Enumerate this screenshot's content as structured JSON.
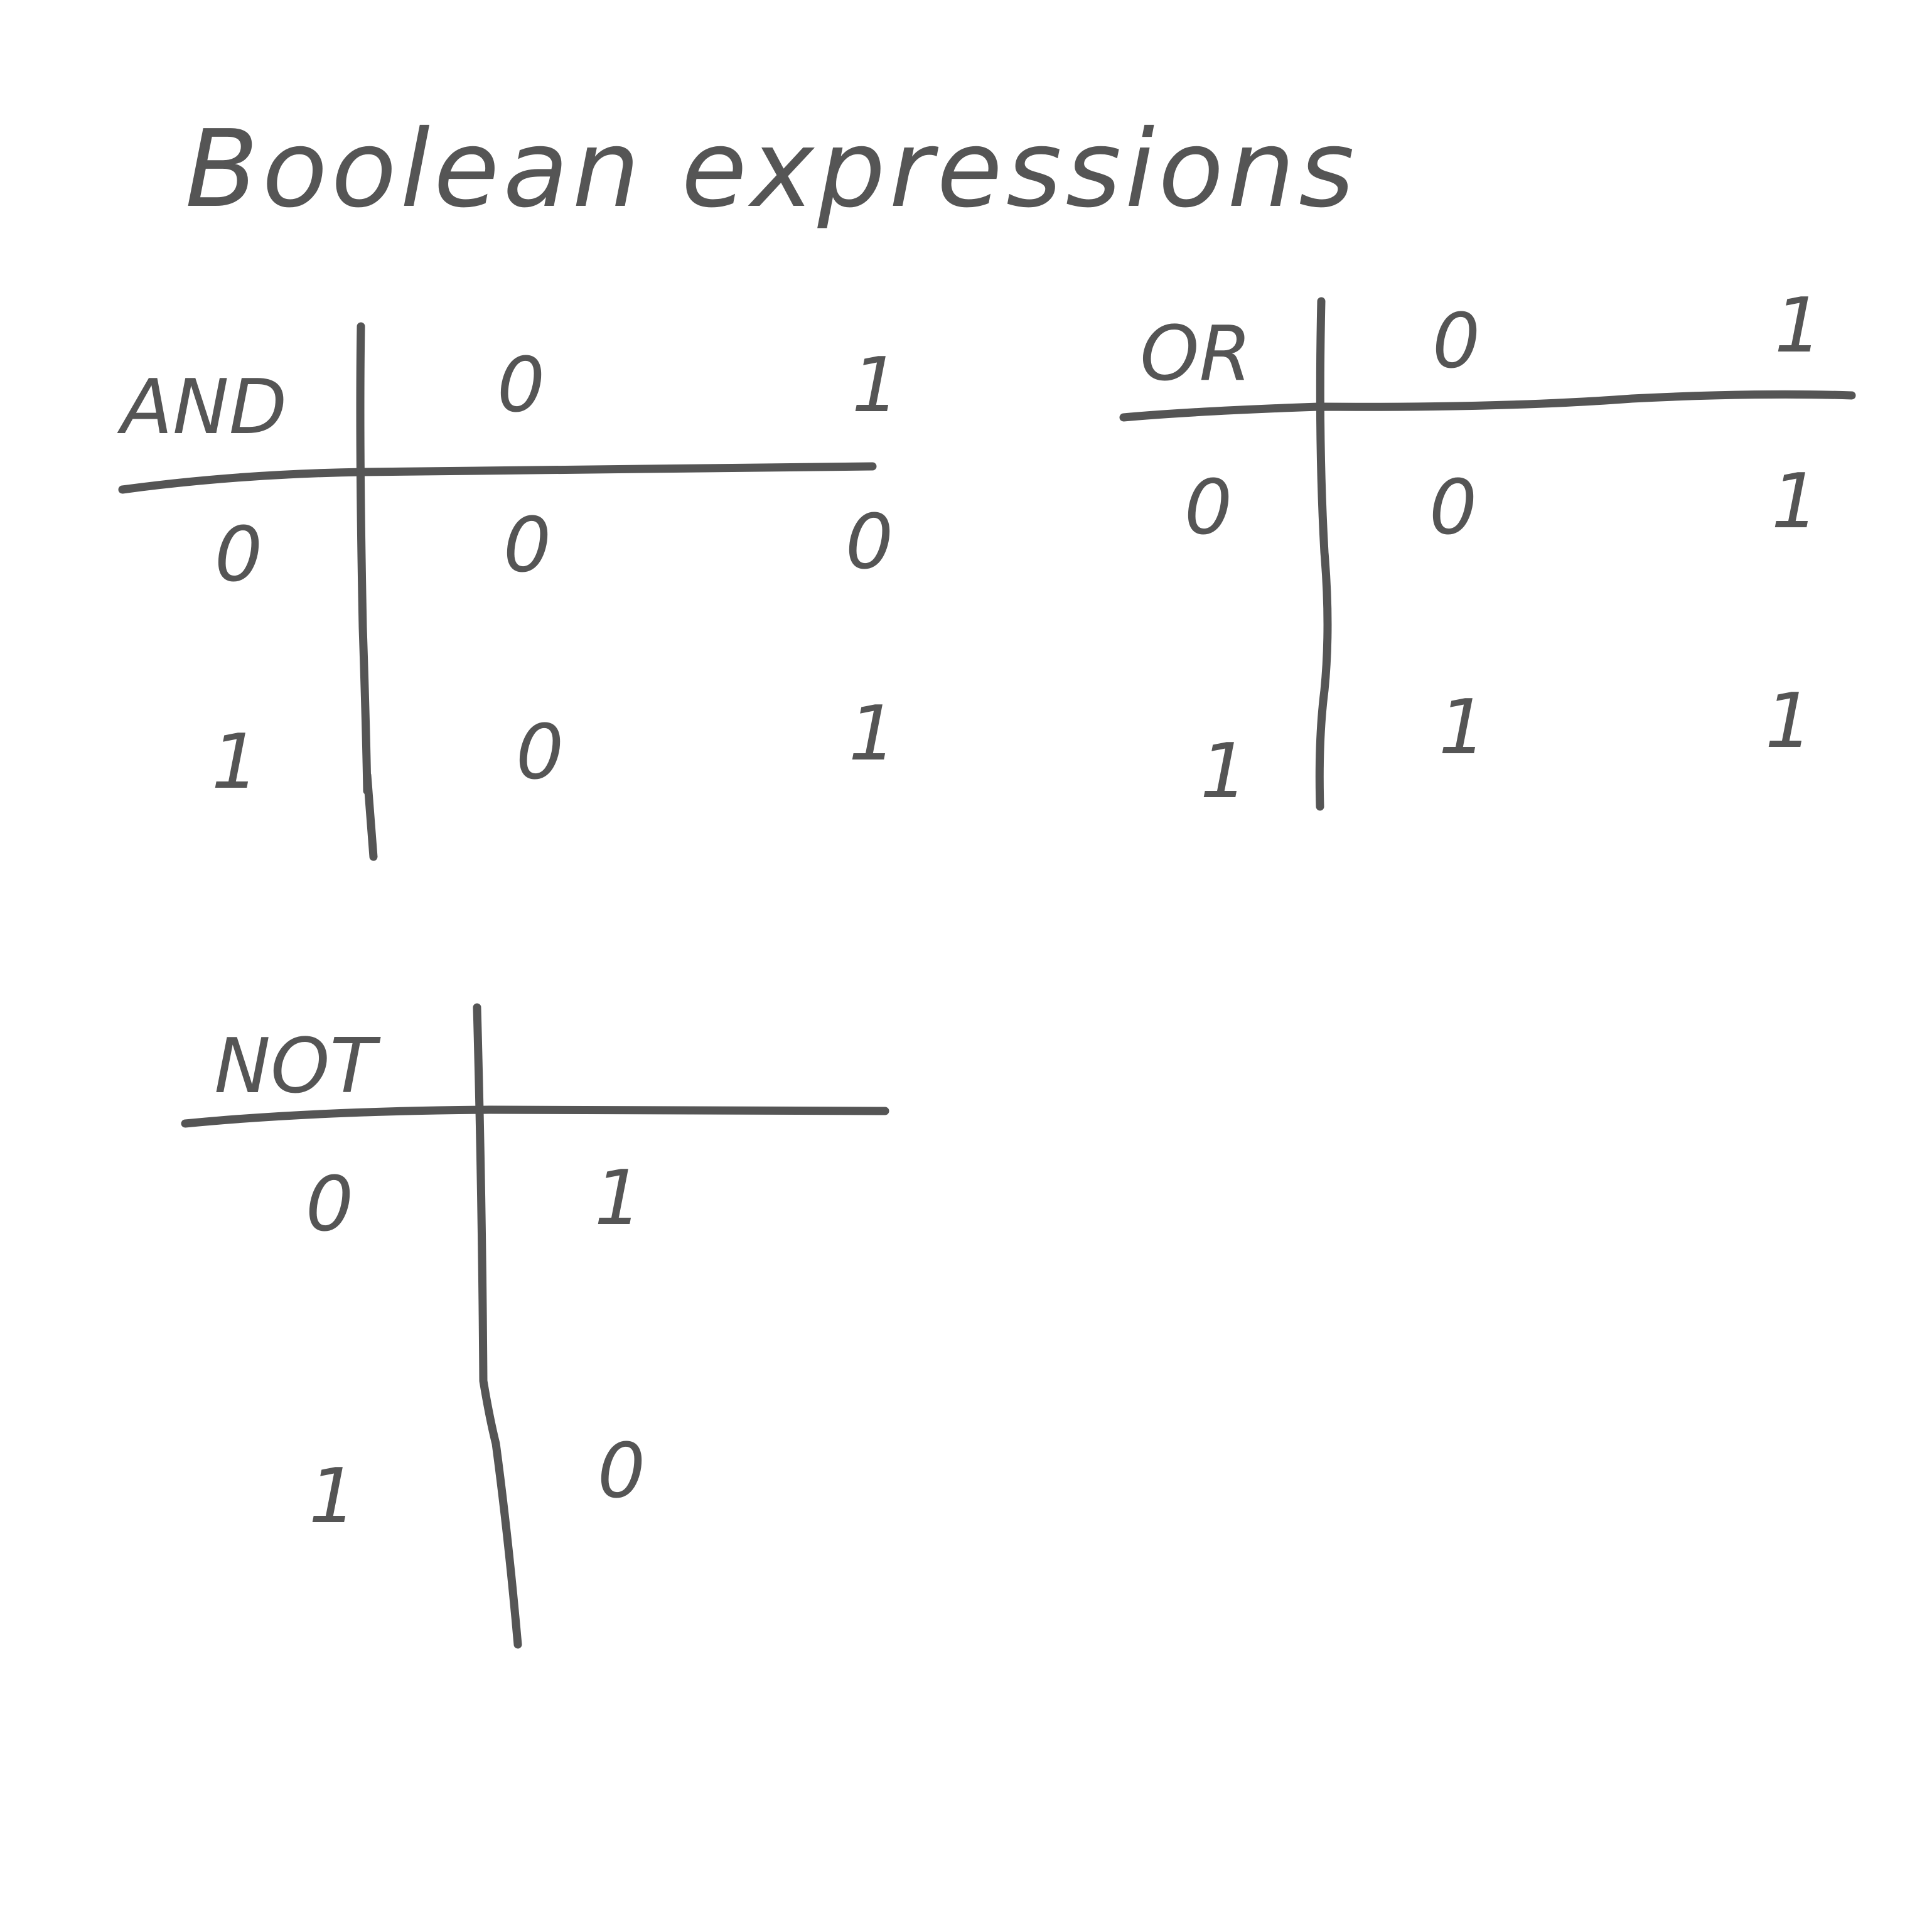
{
  "title": "Boolean expressions",
  "tables": {
    "and": {
      "operator": "AND",
      "column_headers": [
        "0",
        "1"
      ],
      "row_headers": [
        "0",
        "1"
      ],
      "cells": [
        [
          "0",
          "0"
        ],
        [
          "0",
          "1"
        ]
      ]
    },
    "or": {
      "operator": "OR",
      "column_headers": [
        "0",
        "1"
      ],
      "row_headers": [
        "0",
        "1"
      ],
      "cells": [
        [
          "0",
          "1"
        ],
        [
          "1",
          "1"
        ]
      ]
    },
    "not": {
      "operator": "NOT",
      "row_headers": [
        "0",
        "1"
      ],
      "cells": [
        "1",
        "0"
      ]
    }
  },
  "ink_color": "#555555"
}
